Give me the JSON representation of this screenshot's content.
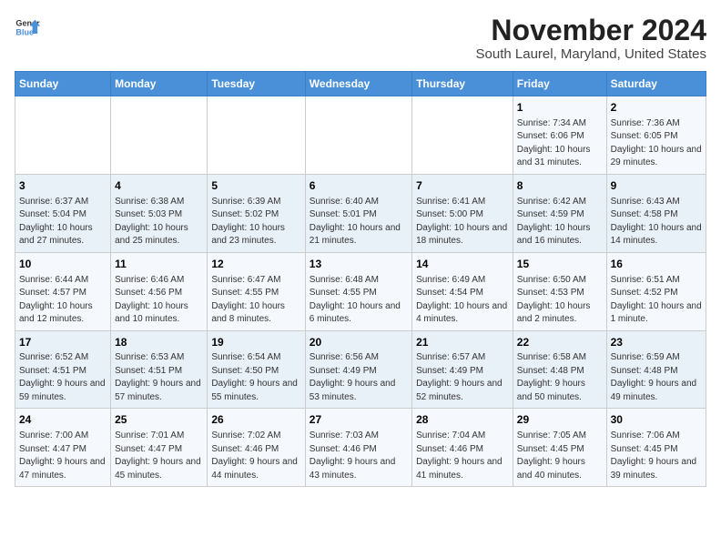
{
  "logo": {
    "text_general": "General",
    "text_blue": "Blue"
  },
  "title": "November 2024",
  "subtitle": "South Laurel, Maryland, United States",
  "header": {
    "days": [
      "Sunday",
      "Monday",
      "Tuesday",
      "Wednesday",
      "Thursday",
      "Friday",
      "Saturday"
    ]
  },
  "weeks": [
    {
      "days": [
        {
          "number": "",
          "info": ""
        },
        {
          "number": "",
          "info": ""
        },
        {
          "number": "",
          "info": ""
        },
        {
          "number": "",
          "info": ""
        },
        {
          "number": "",
          "info": ""
        },
        {
          "number": "1",
          "info": "Sunrise: 7:34 AM\nSunset: 6:06 PM\nDaylight: 10 hours and 31 minutes."
        },
        {
          "number": "2",
          "info": "Sunrise: 7:36 AM\nSunset: 6:05 PM\nDaylight: 10 hours and 29 minutes."
        }
      ]
    },
    {
      "days": [
        {
          "number": "3",
          "info": "Sunrise: 6:37 AM\nSunset: 5:04 PM\nDaylight: 10 hours and 27 minutes."
        },
        {
          "number": "4",
          "info": "Sunrise: 6:38 AM\nSunset: 5:03 PM\nDaylight: 10 hours and 25 minutes."
        },
        {
          "number": "5",
          "info": "Sunrise: 6:39 AM\nSunset: 5:02 PM\nDaylight: 10 hours and 23 minutes."
        },
        {
          "number": "6",
          "info": "Sunrise: 6:40 AM\nSunset: 5:01 PM\nDaylight: 10 hours and 21 minutes."
        },
        {
          "number": "7",
          "info": "Sunrise: 6:41 AM\nSunset: 5:00 PM\nDaylight: 10 hours and 18 minutes."
        },
        {
          "number": "8",
          "info": "Sunrise: 6:42 AM\nSunset: 4:59 PM\nDaylight: 10 hours and 16 minutes."
        },
        {
          "number": "9",
          "info": "Sunrise: 6:43 AM\nSunset: 4:58 PM\nDaylight: 10 hours and 14 minutes."
        }
      ]
    },
    {
      "days": [
        {
          "number": "10",
          "info": "Sunrise: 6:44 AM\nSunset: 4:57 PM\nDaylight: 10 hours and 12 minutes."
        },
        {
          "number": "11",
          "info": "Sunrise: 6:46 AM\nSunset: 4:56 PM\nDaylight: 10 hours and 10 minutes."
        },
        {
          "number": "12",
          "info": "Sunrise: 6:47 AM\nSunset: 4:55 PM\nDaylight: 10 hours and 8 minutes."
        },
        {
          "number": "13",
          "info": "Sunrise: 6:48 AM\nSunset: 4:55 PM\nDaylight: 10 hours and 6 minutes."
        },
        {
          "number": "14",
          "info": "Sunrise: 6:49 AM\nSunset: 4:54 PM\nDaylight: 10 hours and 4 minutes."
        },
        {
          "number": "15",
          "info": "Sunrise: 6:50 AM\nSunset: 4:53 PM\nDaylight: 10 hours and 2 minutes."
        },
        {
          "number": "16",
          "info": "Sunrise: 6:51 AM\nSunset: 4:52 PM\nDaylight: 10 hours and 1 minute."
        }
      ]
    },
    {
      "days": [
        {
          "number": "17",
          "info": "Sunrise: 6:52 AM\nSunset: 4:51 PM\nDaylight: 9 hours and 59 minutes."
        },
        {
          "number": "18",
          "info": "Sunrise: 6:53 AM\nSunset: 4:51 PM\nDaylight: 9 hours and 57 minutes."
        },
        {
          "number": "19",
          "info": "Sunrise: 6:54 AM\nSunset: 4:50 PM\nDaylight: 9 hours and 55 minutes."
        },
        {
          "number": "20",
          "info": "Sunrise: 6:56 AM\nSunset: 4:49 PM\nDaylight: 9 hours and 53 minutes."
        },
        {
          "number": "21",
          "info": "Sunrise: 6:57 AM\nSunset: 4:49 PM\nDaylight: 9 hours and 52 minutes."
        },
        {
          "number": "22",
          "info": "Sunrise: 6:58 AM\nSunset: 4:48 PM\nDaylight: 9 hours and 50 minutes."
        },
        {
          "number": "23",
          "info": "Sunrise: 6:59 AM\nSunset: 4:48 PM\nDaylight: 9 hours and 49 minutes."
        }
      ]
    },
    {
      "days": [
        {
          "number": "24",
          "info": "Sunrise: 7:00 AM\nSunset: 4:47 PM\nDaylight: 9 hours and 47 minutes."
        },
        {
          "number": "25",
          "info": "Sunrise: 7:01 AM\nSunset: 4:47 PM\nDaylight: 9 hours and 45 minutes."
        },
        {
          "number": "26",
          "info": "Sunrise: 7:02 AM\nSunset: 4:46 PM\nDaylight: 9 hours and 44 minutes."
        },
        {
          "number": "27",
          "info": "Sunrise: 7:03 AM\nSunset: 4:46 PM\nDaylight: 9 hours and 43 minutes."
        },
        {
          "number": "28",
          "info": "Sunrise: 7:04 AM\nSunset: 4:46 PM\nDaylight: 9 hours and 41 minutes."
        },
        {
          "number": "29",
          "info": "Sunrise: 7:05 AM\nSunset: 4:45 PM\nDaylight: 9 hours and 40 minutes."
        },
        {
          "number": "30",
          "info": "Sunrise: 7:06 AM\nSunset: 4:45 PM\nDaylight: 9 hours and 39 minutes."
        }
      ]
    }
  ]
}
